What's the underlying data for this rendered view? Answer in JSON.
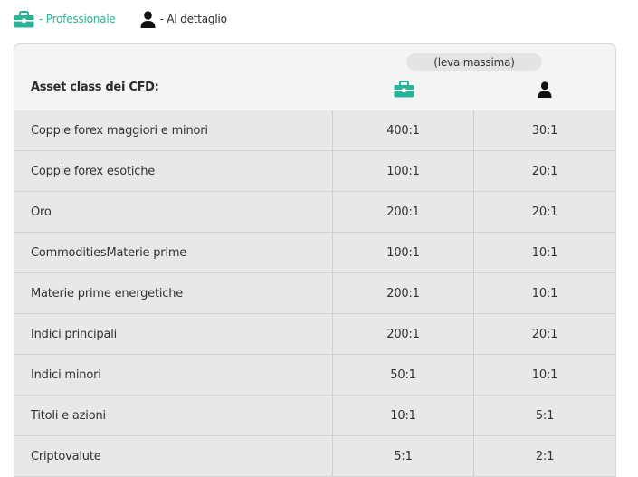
{
  "legend": {
    "professional_label": "- Professionale",
    "retail_label": "- Al dettaglio"
  },
  "table": {
    "leverage_note": "(leva massima)",
    "asset_header": "Asset class dei CFD:",
    "rows": [
      {
        "asset": "Coppie forex maggiori e minori",
        "professional": "400:1",
        "retail": "30:1"
      },
      {
        "asset": "Coppie forex esotiche",
        "professional": "100:1",
        "retail": "20:1"
      },
      {
        "asset": "Oro",
        "professional": "200:1",
        "retail": "20:1"
      },
      {
        "asset": "CommoditiesMaterie prime",
        "professional": "100:1",
        "retail": "10:1"
      },
      {
        "asset": "Materie prime energetiche",
        "professional": "200:1",
        "retail": "10:1"
      },
      {
        "asset": "Indici principali",
        "professional": "200:1",
        "retail": "20:1"
      },
      {
        "asset": "Indici minori",
        "professional": "50:1",
        "retail": "10:1"
      },
      {
        "asset": "Titoli e azioni",
        "professional": "10:1",
        "retail": "5:1"
      },
      {
        "asset": "Criptovalute",
        "professional": "5:1",
        "retail": "2:1"
      }
    ]
  },
  "icons": {
    "professional": "briefcase-icon",
    "retail": "person-icon"
  },
  "colors": {
    "accent": "#2bb39a",
    "header_bg": "#f4f4f4",
    "row_bg": "#e8e8e8"
  }
}
